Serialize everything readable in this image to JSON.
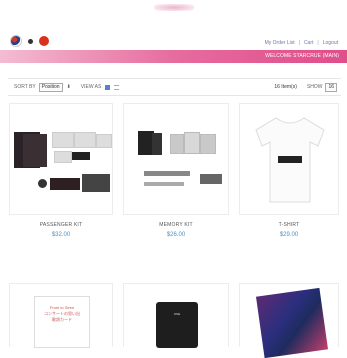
{
  "header": {
    "top_links": [
      "My Order List",
      "|",
      "Cart",
      "|",
      "Logout"
    ],
    "welcome": "WELCOME STARCRUE (MAIN)"
  },
  "toolbar": {
    "sort_label": "SORT BY",
    "sort_value": "Position",
    "view_label": "VIEW AS",
    "count": "16 Item(s)",
    "show_label": "SHOW",
    "show_value": "16"
  },
  "products": [
    {
      "name": "PASSENGER KIT",
      "price": "$32.00"
    },
    {
      "name": "MEMORY KIT",
      "price": "$26.00"
    },
    {
      "name": "T-SHIRT",
      "price": "$29.00"
    }
  ],
  "bottom_text": {
    "card_lines": [
      "From to Seen",
      "コンサートの思い出",
      "歌詞カード"
    ],
    "cup_text": "ONE"
  }
}
